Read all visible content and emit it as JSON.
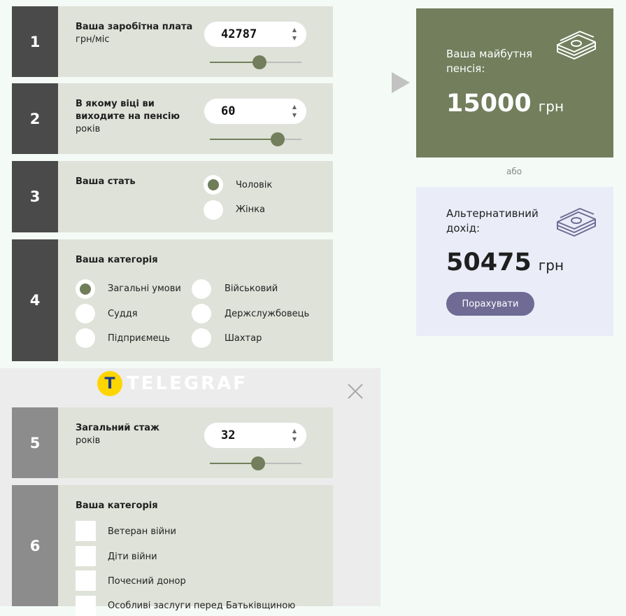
{
  "cards": {
    "salary": {
      "number": "1",
      "title": "Ваша заробітна плата",
      "unit": "грн/міс",
      "value": "42787",
      "slider_fraction": 0.54
    },
    "age": {
      "number": "2",
      "title": "В якому віці ви виходите на пенсію",
      "unit": "років",
      "value": "60",
      "slider_fraction": 0.74
    },
    "gender": {
      "number": "3",
      "title": "Ваша стать",
      "options": [
        {
          "label": "Чоловік",
          "selected": true
        },
        {
          "label": "Жінка",
          "selected": false
        }
      ]
    },
    "category": {
      "number": "4",
      "title": "Ваша категорія",
      "options": [
        {
          "label": "Загальні умови",
          "selected": true
        },
        {
          "label": "Військовий",
          "selected": false
        },
        {
          "label": "Суддя",
          "selected": false
        },
        {
          "label": "Держслужбовець",
          "selected": false
        },
        {
          "label": "Підприємець",
          "selected": false
        },
        {
          "label": "Шахтар",
          "selected": false
        }
      ]
    },
    "experience": {
      "number": "5",
      "title": "Загальний стаж",
      "unit": "років",
      "value": "32",
      "slider_fraction": 0.53
    },
    "category2": {
      "number": "6",
      "title": "Ваша категорія",
      "options": [
        {
          "label": "Ветеран війни",
          "checked": false
        },
        {
          "label": "Діти війни",
          "checked": false
        },
        {
          "label": "Почесний донор",
          "checked": false
        },
        {
          "label": "Особливі заслуги перед Батьківщиною",
          "checked": false
        }
      ]
    }
  },
  "overlay": {
    "logo_letter": "T",
    "logo_text": "TELEGRAF",
    "close_icon": "close-icon"
  },
  "results": {
    "pension_title": "Ваша майбутня пенсія:",
    "pension_amount": "15000",
    "pension_unit": "грн",
    "or_label": "або",
    "alt_title": "Альтернативний дохід:",
    "alt_amount": "50475",
    "alt_unit": "грн",
    "calc_button": "Порахувати",
    "money_icon": "money-stack-icon"
  },
  "colors": {
    "accent_green": "#727e5c",
    "alt_panel": "#eaedf8",
    "button_purple": "#6f6b95",
    "logo_yellow": "#ffd500"
  }
}
